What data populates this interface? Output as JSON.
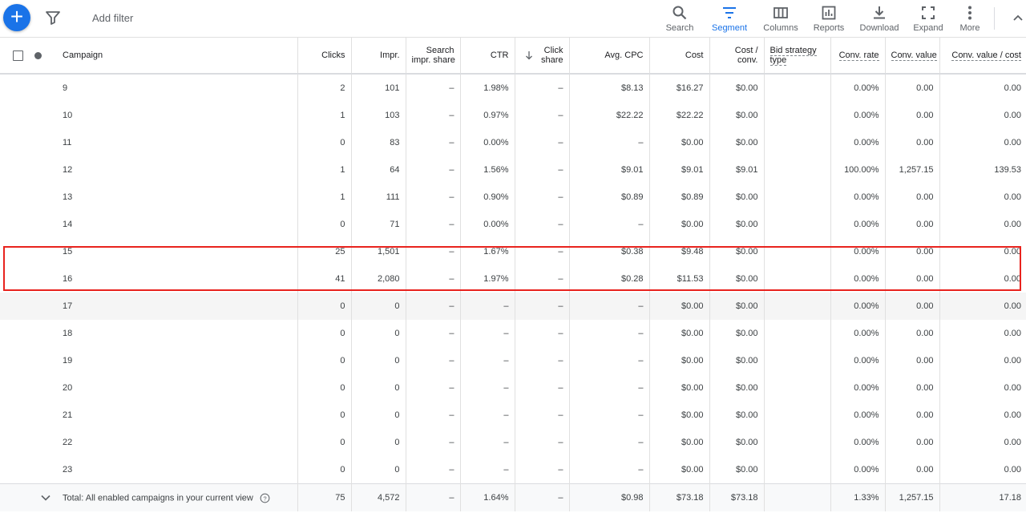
{
  "toolbar": {
    "fab_label": "+",
    "add_filter": "Add filter",
    "buttons": [
      {
        "label": "Search",
        "icon": "search-icon"
      },
      {
        "label": "Segment",
        "icon": "segment-icon",
        "active": true
      },
      {
        "label": "Columns",
        "icon": "columns-icon"
      },
      {
        "label": "Reports",
        "icon": "reports-icon"
      },
      {
        "label": "Download",
        "icon": "download-icon"
      },
      {
        "label": "Expand",
        "icon": "expand-icon"
      },
      {
        "label": "More",
        "icon": "more-vert-icon"
      }
    ]
  },
  "table": {
    "headers": {
      "campaign": "Campaign",
      "clicks": "Clicks",
      "impr": "Impr.",
      "search_impr_share_1": "Search",
      "search_impr_share_2": "impr. share",
      "ctr": "CTR",
      "click_share_1": "Click",
      "click_share_2": "share",
      "avg_cpc": "Avg. CPC",
      "cost": "Cost",
      "cost_conv_1": "Cost /",
      "cost_conv_2": "conv.",
      "bid_strategy_1": "Bid strategy",
      "bid_strategy_2": "type",
      "conv_rate": "Conv. rate",
      "conv_value": "Conv. value",
      "conv_value_cost": "Conv. value / cost"
    },
    "rows": [
      {
        "campaign": "9",
        "clicks": "2",
        "impr": "101",
        "sis": "–",
        "ctr": "1.98%",
        "cs": "–",
        "cpc": "$8.13",
        "cost": "$16.27",
        "cpconv": "$0.00",
        "bid": "",
        "cr": "0.00%",
        "cv": "0.00",
        "cvc": "0.00"
      },
      {
        "campaign": "10",
        "clicks": "1",
        "impr": "103",
        "sis": "–",
        "ctr": "0.97%",
        "cs": "–",
        "cpc": "$22.22",
        "cost": "$22.22",
        "cpconv": "$0.00",
        "bid": "",
        "cr": "0.00%",
        "cv": "0.00",
        "cvc": "0.00"
      },
      {
        "campaign": "11",
        "clicks": "0",
        "impr": "83",
        "sis": "–",
        "ctr": "0.00%",
        "cs": "–",
        "cpc": "–",
        "cost": "$0.00",
        "cpconv": "$0.00",
        "bid": "",
        "cr": "0.00%",
        "cv": "0.00",
        "cvc": "0.00"
      },
      {
        "campaign": "12",
        "clicks": "1",
        "impr": "64",
        "sis": "–",
        "ctr": "1.56%",
        "cs": "–",
        "cpc": "$9.01",
        "cost": "$9.01",
        "cpconv": "$9.01",
        "bid": "",
        "cr": "100.00%",
        "cv": "1,257.15",
        "cvc": "139.53"
      },
      {
        "campaign": "13",
        "clicks": "1",
        "impr": "111",
        "sis": "–",
        "ctr": "0.90%",
        "cs": "–",
        "cpc": "$0.89",
        "cost": "$0.89",
        "cpconv": "$0.00",
        "bid": "",
        "cr": "0.00%",
        "cv": "0.00",
        "cvc": "0.00"
      },
      {
        "campaign": "14",
        "clicks": "0",
        "impr": "71",
        "sis": "–",
        "ctr": "0.00%",
        "cs": "–",
        "cpc": "–",
        "cost": "$0.00",
        "cpconv": "$0.00",
        "bid": "",
        "cr": "0.00%",
        "cv": "0.00",
        "cvc": "0.00"
      },
      {
        "campaign": "15",
        "clicks": "25",
        "impr": "1,501",
        "sis": "–",
        "ctr": "1.67%",
        "cs": "–",
        "cpc": "$0.38",
        "cost": "$9.48",
        "cpconv": "$0.00",
        "bid": "",
        "cr": "0.00%",
        "cv": "0.00",
        "cvc": "0.00"
      },
      {
        "campaign": "16",
        "clicks": "41",
        "impr": "2,080",
        "sis": "–",
        "ctr": "1.97%",
        "cs": "–",
        "cpc": "$0.28",
        "cost": "$11.53",
        "cpconv": "$0.00",
        "bid": "",
        "cr": "0.00%",
        "cv": "0.00",
        "cvc": "0.00"
      },
      {
        "campaign": "17",
        "clicks": "0",
        "impr": "0",
        "sis": "–",
        "ctr": "–",
        "cs": "–",
        "cpc": "–",
        "cost": "$0.00",
        "cpconv": "$0.00",
        "bid": "",
        "cr": "0.00%",
        "cv": "0.00",
        "cvc": "0.00"
      },
      {
        "campaign": "18",
        "clicks": "0",
        "impr": "0",
        "sis": "–",
        "ctr": "–",
        "cs": "–",
        "cpc": "–",
        "cost": "$0.00",
        "cpconv": "$0.00",
        "bid": "",
        "cr": "0.00%",
        "cv": "0.00",
        "cvc": "0.00"
      },
      {
        "campaign": "19",
        "clicks": "0",
        "impr": "0",
        "sis": "–",
        "ctr": "–",
        "cs": "–",
        "cpc": "–",
        "cost": "$0.00",
        "cpconv": "$0.00",
        "bid": "",
        "cr": "0.00%",
        "cv": "0.00",
        "cvc": "0.00"
      },
      {
        "campaign": "20",
        "clicks": "0",
        "impr": "0",
        "sis": "–",
        "ctr": "–",
        "cs": "–",
        "cpc": "–",
        "cost": "$0.00",
        "cpconv": "$0.00",
        "bid": "",
        "cr": "0.00%",
        "cv": "0.00",
        "cvc": "0.00"
      },
      {
        "campaign": "21",
        "clicks": "0",
        "impr": "0",
        "sis": "–",
        "ctr": "–",
        "cs": "–",
        "cpc": "–",
        "cost": "$0.00",
        "cpconv": "$0.00",
        "bid": "",
        "cr": "0.00%",
        "cv": "0.00",
        "cvc": "0.00"
      },
      {
        "campaign": "22",
        "clicks": "0",
        "impr": "0",
        "sis": "–",
        "ctr": "–",
        "cs": "–",
        "cpc": "–",
        "cost": "$0.00",
        "cpconv": "$0.00",
        "bid": "",
        "cr": "0.00%",
        "cv": "0.00",
        "cvc": "0.00"
      },
      {
        "campaign": "23",
        "clicks": "0",
        "impr": "0",
        "sis": "–",
        "ctr": "–",
        "cs": "–",
        "cpc": "–",
        "cost": "$0.00",
        "cpconv": "$0.00",
        "bid": "",
        "cr": "0.00%",
        "cv": "0.00",
        "cvc": "0.00"
      }
    ],
    "shaded_row_campaign": "17",
    "highlighted_campaigns": [
      "15",
      "16"
    ],
    "highlight_color": "#e8231e",
    "total": {
      "label": "Total: All enabled campaigns in your current view",
      "clicks": "75",
      "impr": "4,572",
      "sis": "–",
      "ctr": "1.64%",
      "cs": "–",
      "cpc": "$0.98",
      "cost": "$73.18",
      "cpconv": "$73.18",
      "bid": "",
      "cr": "1.33%",
      "cv": "1,257.15",
      "cvc": "17.18"
    }
  },
  "colors": {
    "accent": "#1a73e8",
    "text": "#3c4043",
    "highlight": "#e8231e"
  }
}
